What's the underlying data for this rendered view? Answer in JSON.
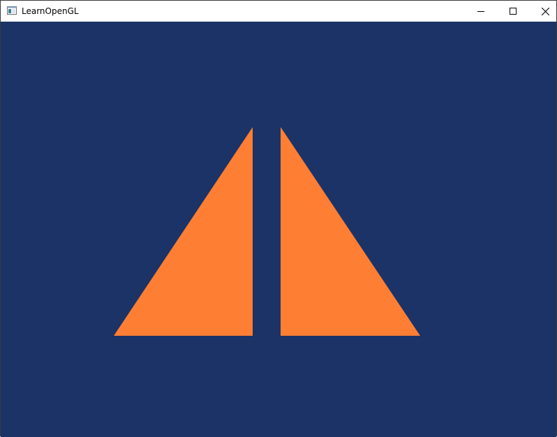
{
  "window": {
    "title": "LearnOpenGL",
    "title_color": "#000000",
    "titlebar_color": "#ffffff"
  },
  "caption_buttons": {
    "minimize": "minimize-icon",
    "maximize": "maximize-icon",
    "close": "close-icon"
  },
  "scene": {
    "clear_color": "#1b3366",
    "triangle_color": "#fe7f33",
    "triangle_count": 2
  }
}
